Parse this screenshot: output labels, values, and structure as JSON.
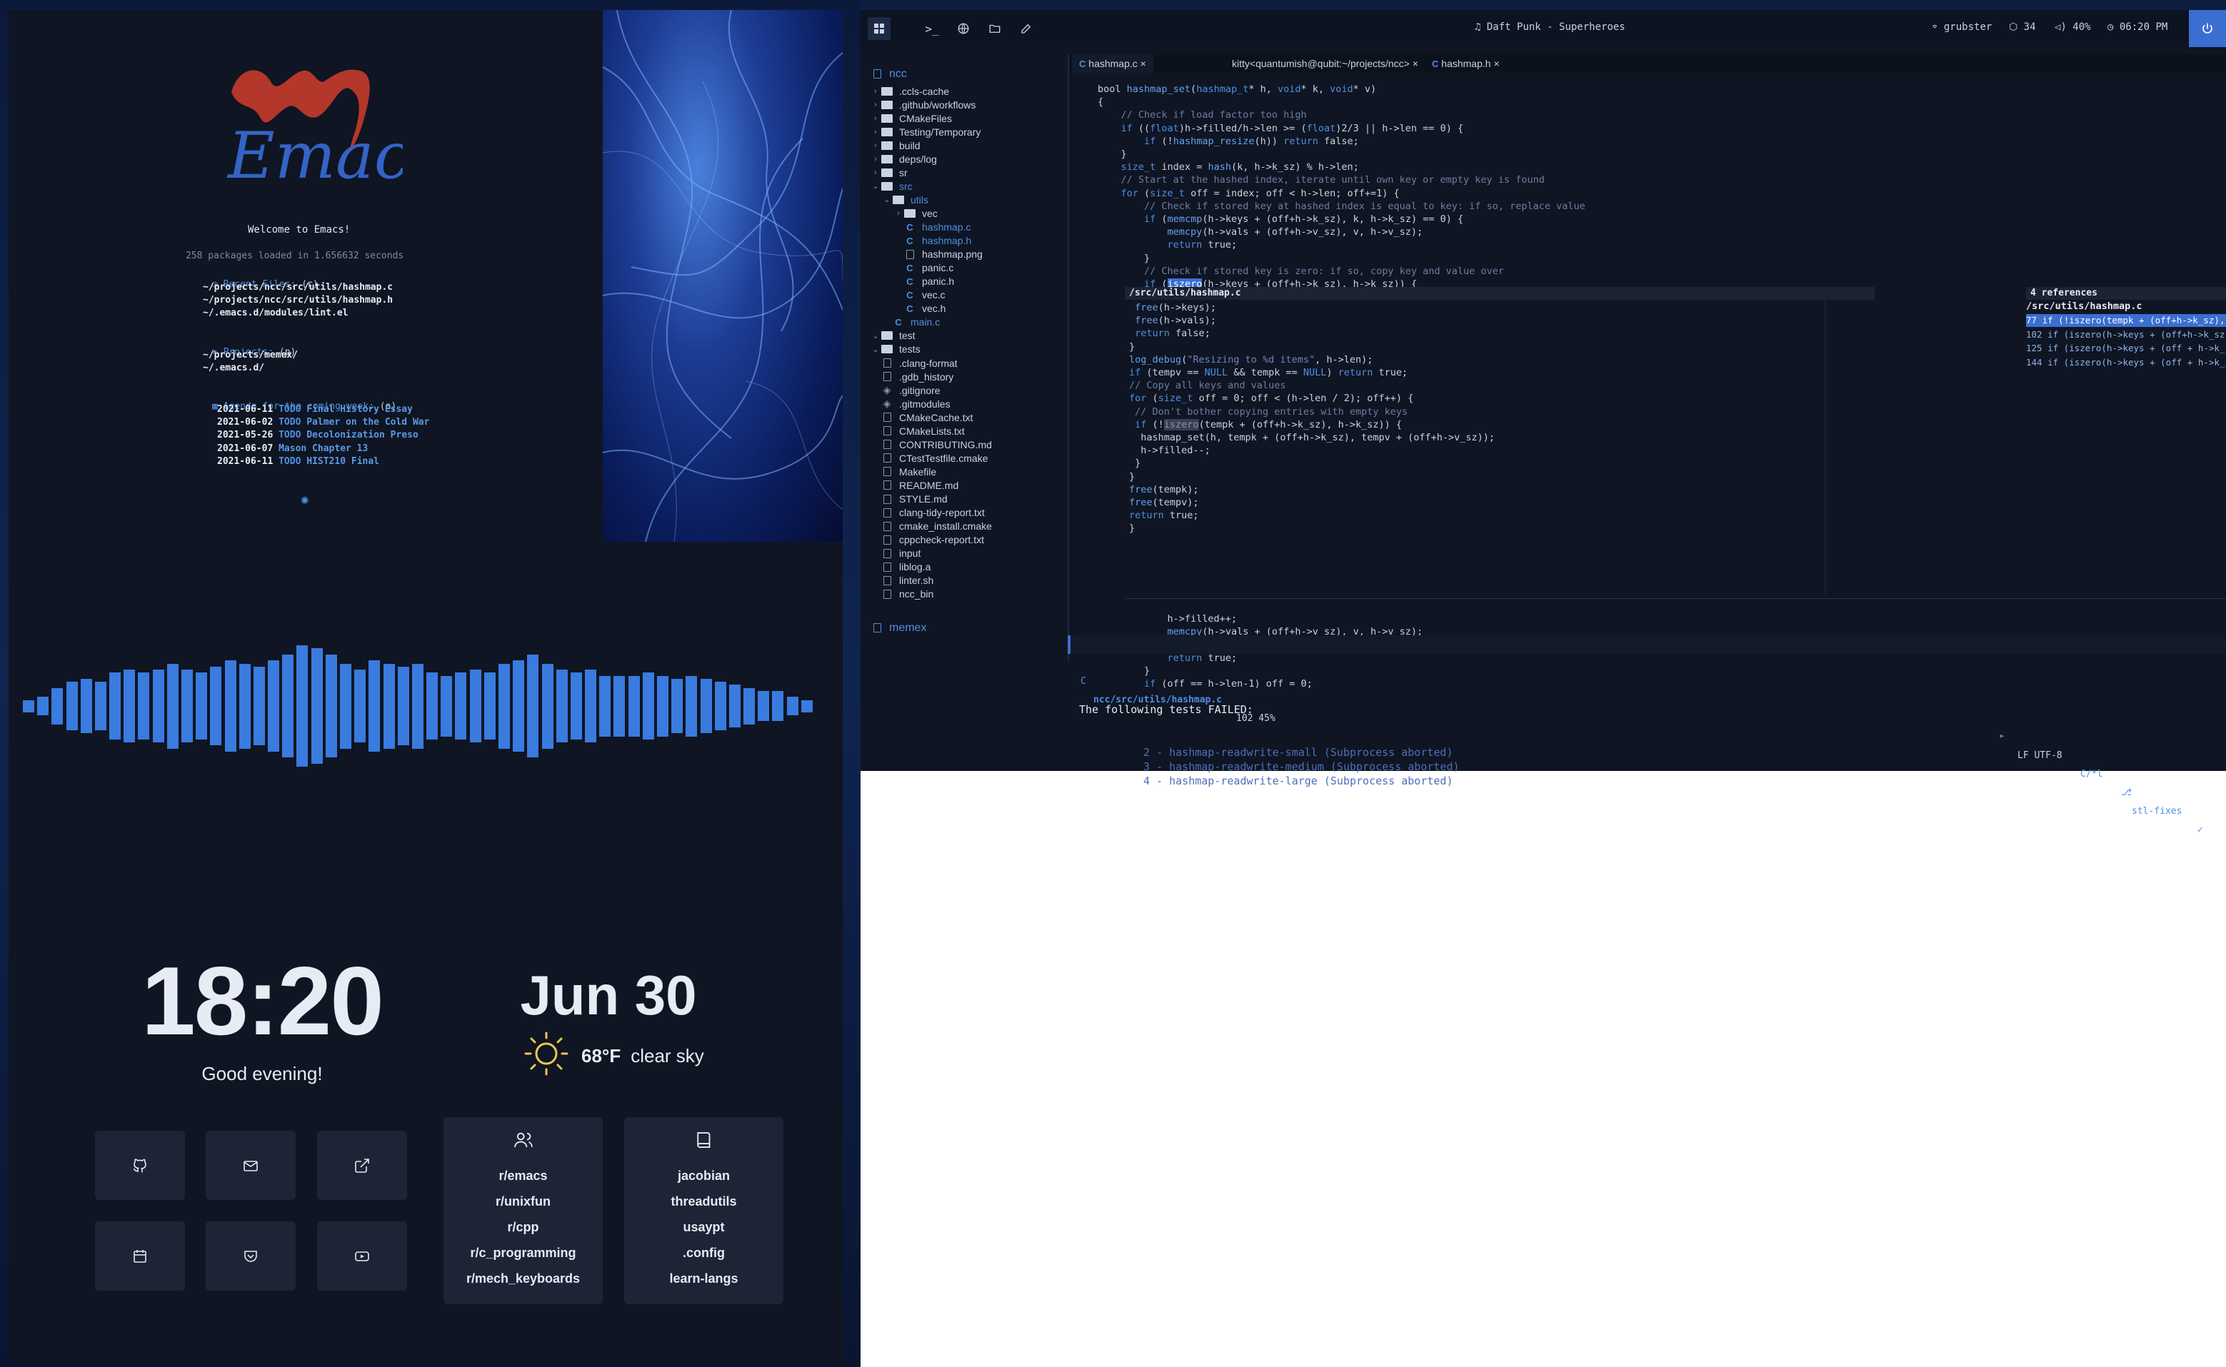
{
  "dashboard": {
    "welcome": "Welcome to Emacs!",
    "loaded": "258 packages loaded in 1.656632 seconds",
    "recent": {
      "heading": "Recent Files:",
      "key": "(r)",
      "items": [
        "~/projects/ncc/src/utils/hashmap.c",
        "~/projects/ncc/src/utils/hashmap.h",
        "~/.emacs.d/modules/lint.el"
      ]
    },
    "projects": {
      "heading": "Projects:",
      "key": "(p)",
      "items": [
        "~/projects/memex/",
        "~/.emacs.d/"
      ]
    },
    "agenda": {
      "heading": "Agenda for the coming week:",
      "key": "(a)",
      "items": [
        {
          "date": "2021-06-11",
          "state": "TODO",
          "text": "Final History Essay"
        },
        {
          "date": "2021-06-02",
          "state": "TODO",
          "text": "Palmer on the Cold War"
        },
        {
          "date": "2021-05-26",
          "state": "TODO",
          "text": "Decolonization Preso"
        },
        {
          "date": "2021-06-07",
          "state": "",
          "text": "Mason Chapter 13"
        },
        {
          "date": "2021-06-11",
          "state": "TODO",
          "text": "HIST210 Final"
        }
      ]
    }
  },
  "visualizer": {
    "levels": [
      0.1,
      0.15,
      0.3,
      0.4,
      0.45,
      0.4,
      0.55,
      0.6,
      0.55,
      0.6,
      0.7,
      0.6,
      0.55,
      0.65,
      0.75,
      0.7,
      0.65,
      0.75,
      0.85,
      1.0,
      0.95,
      0.85,
      0.7,
      0.6,
      0.75,
      0.7,
      0.65,
      0.7,
      0.55,
      0.5,
      0.55,
      0.6,
      0.55,
      0.7,
      0.75,
      0.85,
      0.7,
      0.6,
      0.55,
      0.6,
      0.5,
      0.5,
      0.5,
      0.55,
      0.5,
      0.45,
      0.5,
      0.45,
      0.4,
      0.35,
      0.3,
      0.25,
      0.25,
      0.15,
      0.1
    ],
    "color": "#3a7be0"
  },
  "clock": {
    "time": "18:20",
    "greeting": "Good evening!"
  },
  "weather": {
    "date": "Jun 30",
    "temp": "68°F",
    "desc": "clear sky"
  },
  "quicklinks": {
    "icons": [
      "github-icon",
      "mail-icon",
      "external-link-icon",
      "calendar-icon",
      "pocket-icon",
      "youtube-icon"
    ],
    "reddit": [
      "r/emacs",
      "r/unixfun",
      "r/cpp",
      "r/c_programming",
      "r/mech_keyboards"
    ],
    "github": [
      "jacobian",
      "threadutils",
      "usaypt",
      ".config",
      "learn-langs"
    ]
  },
  "topbar": {
    "music": "Daft Punk - Superheroes",
    "wifi": "grubster",
    "packages": "34",
    "volume": "40%",
    "time": "06:20 PM"
  },
  "tree": {
    "project": "ncc",
    "items": [
      {
        "label": ".ccls-cache",
        "type": "folder",
        "depth": 0,
        "open": false
      },
      {
        "label": ".github/workflows",
        "type": "folder",
        "depth": 0,
        "open": false
      },
      {
        "label": "CMakeFiles",
        "type": "folder",
        "depth": 0,
        "open": false
      },
      {
        "label": "Testing/Temporary",
        "type": "folder",
        "depth": 0,
        "open": false
      },
      {
        "label": "build",
        "type": "folder",
        "depth": 0,
        "open": false
      },
      {
        "label": "deps/log",
        "type": "folder",
        "depth": 0,
        "open": false
      },
      {
        "label": "sr",
        "type": "folder",
        "depth": 0,
        "open": false
      },
      {
        "label": "src",
        "type": "folder",
        "depth": 0,
        "open": true
      },
      {
        "label": "utils",
        "type": "folder",
        "depth": 1,
        "open": true
      },
      {
        "label": "vec",
        "type": "folder",
        "depth": 2,
        "open": false
      },
      {
        "label": "hashmap.c",
        "type": "c",
        "depth": 2
      },
      {
        "label": "hashmap.h",
        "type": "c",
        "depth": 2
      },
      {
        "label": "hashmap.png",
        "type": "file",
        "depth": 2
      },
      {
        "label": "panic.c",
        "type": "c",
        "depth": 2
      },
      {
        "label": "panic.h",
        "type": "c",
        "depth": 2
      },
      {
        "label": "vec.c",
        "type": "c",
        "depth": 2
      },
      {
        "label": "vec.h",
        "type": "c",
        "depth": 2
      },
      {
        "label": "main.c",
        "type": "c",
        "depth": 1
      },
      {
        "label": "test",
        "type": "folder",
        "depth": 0,
        "open": true
      },
      {
        "label": "tests",
        "type": "folder",
        "depth": 0,
        "open": true
      },
      {
        "label": ".clang-format",
        "type": "file",
        "depth": 0
      },
      {
        "label": ".gdb_history",
        "type": "file",
        "depth": 0
      },
      {
        "label": ".gitignore",
        "type": "git",
        "depth": 0
      },
      {
        "label": ".gitmodules",
        "type": "git",
        "depth": 0
      },
      {
        "label": "CMakeCache.txt",
        "type": "file",
        "depth": 0
      },
      {
        "label": "CMakeLists.txt",
        "type": "file",
        "depth": 0
      },
      {
        "label": "CONTRIBUTING.md",
        "type": "file",
        "depth": 0
      },
      {
        "label": "CTestTestfile.cmake",
        "type": "file",
        "depth": 0
      },
      {
        "label": "Makefile",
        "type": "file",
        "depth": 0
      },
      {
        "label": "README.md",
        "type": "file",
        "depth": 0
      },
      {
        "label": "STYLE.md",
        "type": "file",
        "depth": 0
      },
      {
        "label": "clang-tidy-report.txt",
        "type": "file",
        "depth": 0
      },
      {
        "label": "cmake_install.cmake",
        "type": "file",
        "depth": 0
      },
      {
        "label": "cppcheck-report.txt",
        "type": "file",
        "depth": 0
      },
      {
        "label": "input",
        "type": "file",
        "depth": 0
      },
      {
        "label": "liblog.a",
        "type": "file",
        "depth": 0
      },
      {
        "label": "linter.sh",
        "type": "file",
        "depth": 0
      },
      {
        "label": "ncc_bin",
        "type": "file",
        "depth": 0
      }
    ],
    "second_project": "memex"
  },
  "tabs": [
    "hashmap.c ×",
    "kitty<quantumish@qubit:~/projects/ncc> ×",
    "hashmap.h ×"
  ],
  "peek": {
    "file": "/src/utils/hashmap.c",
    "refs_title": "4 references",
    "refs_file": "/src/utils/hashmap.c",
    "refs_count": "4",
    "refs": [
      {
        "line": "77",
        "text": "if (!iszero(tempk + (off+h->k_sz), h->k_sz.."
      },
      {
        "line": "102",
        "text": "if (iszero(h->keys + (off+h->k_sz), h->k_s.."
      },
      {
        "line": "125",
        "text": "if (iszero(h->keys + (off + h->k_sz), h->k.."
      },
      {
        "line": "144",
        "text": "if (iszero(h->keys + (off + h->k_sz), h->k.."
      }
    ]
  },
  "modeline": {
    "path": "ncc/src/utils/hashmap.c",
    "pos": "102 45%",
    "encoding": "LF UTF-8",
    "mode": "C/*l",
    "branch": "stl-fixes"
  },
  "terminal": {
    "heading": "The following tests FAILED:",
    "items": [
      "2 - hashmap-readwrite-small (Subprocess aborted)",
      "3 - hashmap-readwrite-medium (Subprocess aborted)",
      "4 - hashmap-readwrite-large (Subprocess aborted)"
    ]
  }
}
